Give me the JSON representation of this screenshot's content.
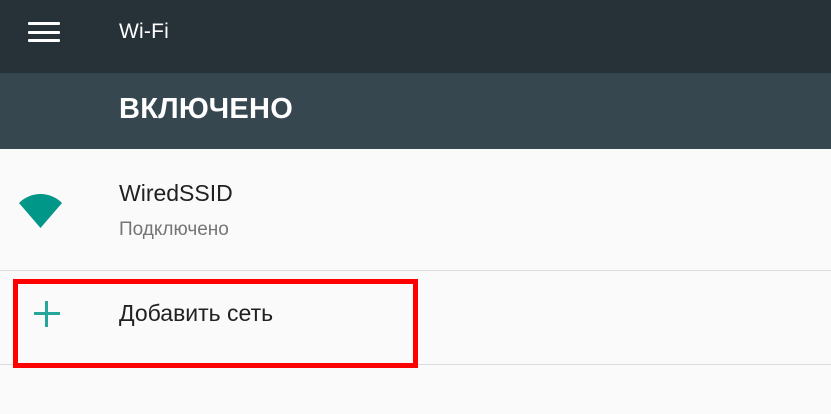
{
  "app_bar": {
    "title": "Wi-Fi",
    "menu_icon": "hamburger-menu-icon"
  },
  "switch_bar": {
    "label": "ВКЛЮЧЕНО"
  },
  "networks": [
    {
      "name": "WiredSSID",
      "status": "Подключено",
      "icon": "wifi-signal-full-icon",
      "icon_color": "#009688"
    }
  ],
  "add_network": {
    "label": "Добавить сеть",
    "icon": "plus-icon",
    "icon_color": "#26a69a"
  },
  "colors": {
    "app_bar": "#263238",
    "switch_bar": "#37474f",
    "background": "#fafafa",
    "accent": "#009688",
    "highlight": "#ff0000"
  }
}
